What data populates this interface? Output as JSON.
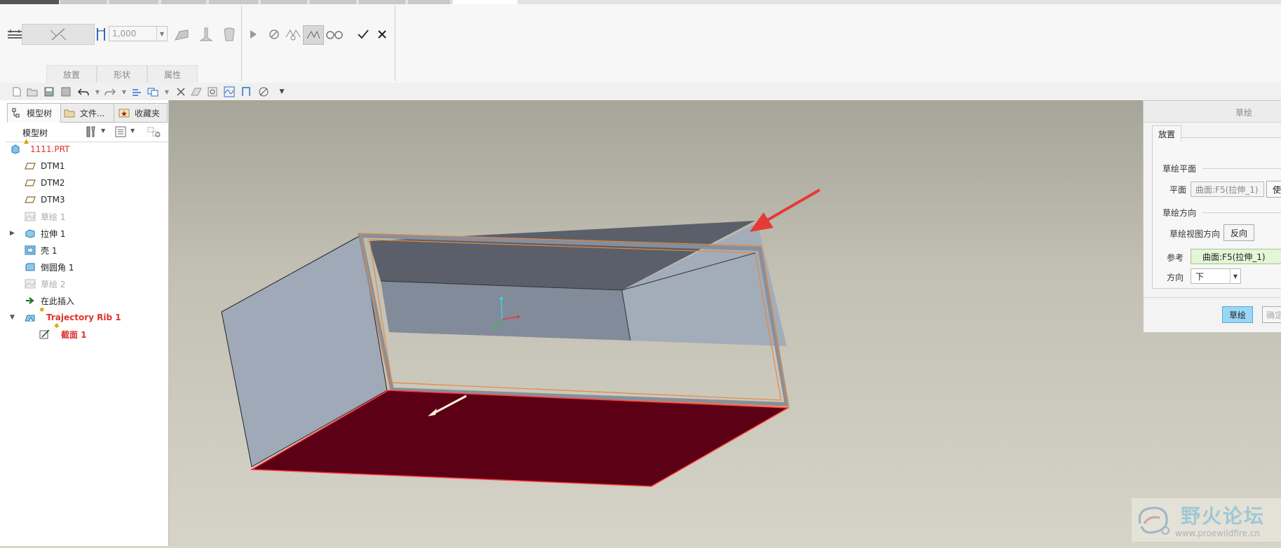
{
  "ribbon": {
    "thickness_value": "1,000",
    "tabs": [
      "放置",
      "形状",
      "属性"
    ]
  },
  "model_tree_panel": {
    "tabs": [
      "模型树",
      "文件...",
      "收藏夹"
    ],
    "header": "模型树",
    "items": [
      {
        "label": "1111.PRT",
        "icon": "part-icon",
        "state": "warning"
      },
      {
        "label": "DTM1",
        "icon": "datum-plane-icon",
        "state": "normal"
      },
      {
        "label": "DTM2",
        "icon": "datum-plane-icon",
        "state": "normal"
      },
      {
        "label": "DTM3",
        "icon": "datum-plane-icon",
        "state": "normal"
      },
      {
        "label": "草绘 1",
        "icon": "sketch-icon",
        "state": "hidden"
      },
      {
        "label": "拉伸 1",
        "icon": "extrude-icon",
        "state": "normal"
      },
      {
        "label": "壳 1",
        "icon": "shell-icon",
        "state": "normal"
      },
      {
        "label": "倒圆角 1",
        "icon": "round-icon",
        "state": "normal"
      },
      {
        "label": "草绘 2",
        "icon": "sketch-icon",
        "state": "hidden"
      },
      {
        "label": "在此插入",
        "icon": "insert-arrow-icon",
        "state": "normal"
      },
      {
        "label": "Trajectory Rib 1",
        "icon": "rib-icon",
        "state": "active"
      },
      {
        "label": "截面 1",
        "icon": "section-icon",
        "state": "active"
      }
    ]
  },
  "sketch_dialog": {
    "title": "草绘",
    "tab": "放置",
    "sketch_plane_group": "草绘平面",
    "plane_label": "平面",
    "plane_value": "曲面:F5(拉伸_1)",
    "use_prev_button": "使",
    "orientation_group": "草绘方向",
    "view_direction_label": "草绘视图方向",
    "flip_button": "反向",
    "reference_label": "参考",
    "reference_value": "曲面:F5(拉伸_1)",
    "direction_label": "方向",
    "direction_value": "下",
    "sketch_button": "草绘",
    "ok_button": "确定"
  },
  "watermark": {
    "title": "野火论坛",
    "url": "www.proewildfire.cn"
  },
  "colors": {
    "accent_red": "#e0322d",
    "active_text": "#e0322d",
    "selected_face": "#5c0016",
    "model_grey": "#9fa9b7",
    "highlight_orange": "#e8883a"
  }
}
